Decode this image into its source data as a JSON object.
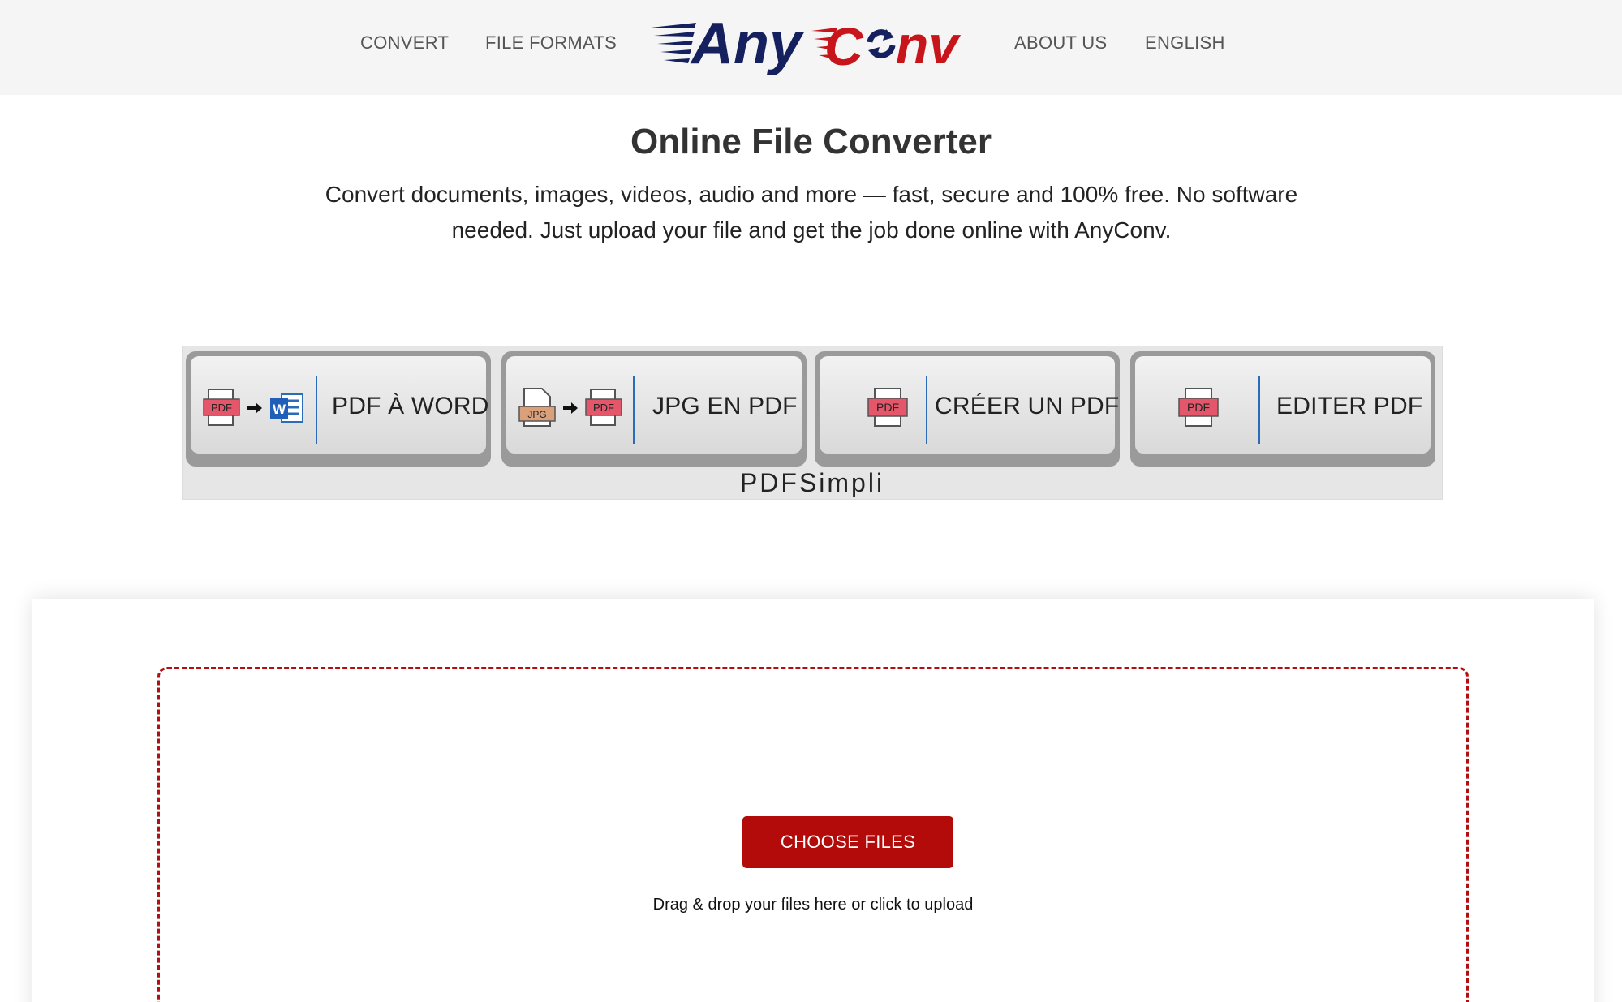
{
  "header": {
    "nav": {
      "convert": "CONVERT",
      "file_formats": "FILE FORMATS",
      "about_us": "ABOUT US",
      "language": "ENGLISH"
    },
    "logo": {
      "part1": "Any",
      "part2": "C",
      "part3": "nv"
    }
  },
  "hero": {
    "title": "Online File Converter",
    "description": "Convert documents, images, videos, audio and more — fast, secure and 100% free. No software needed. Just upload your file and get the job done online with AnyConv."
  },
  "ad": {
    "tiles": [
      {
        "label": "PDF À WORD",
        "icons": [
          "pdf-icon",
          "arrow-right-icon",
          "word-icon"
        ]
      },
      {
        "label": "JPG EN PDF",
        "icons": [
          "jpg-icon",
          "arrow-right-icon",
          "pdf-icon"
        ]
      },
      {
        "label": "CRÉER UN PDF",
        "icons": [
          "pdf-icon"
        ]
      },
      {
        "label": "EDITER PDF",
        "icons": [
          "pdf-icon"
        ]
      }
    ],
    "icon_text": {
      "pdf": "PDF",
      "jpg": "JPG",
      "word": "W"
    },
    "brand": "PDFSimpli",
    "info_icon": "ⓘ",
    "menu_icon": "⋮"
  },
  "upload": {
    "button_label": "CHOOSE FILES",
    "hint": "Drag & drop your files here or click to upload"
  },
  "colors": {
    "brand_red": "#b30a0a",
    "brand_navy": "#14215e",
    "header_bg": "#f5f5f5",
    "dropzone_border": "#b01010"
  }
}
